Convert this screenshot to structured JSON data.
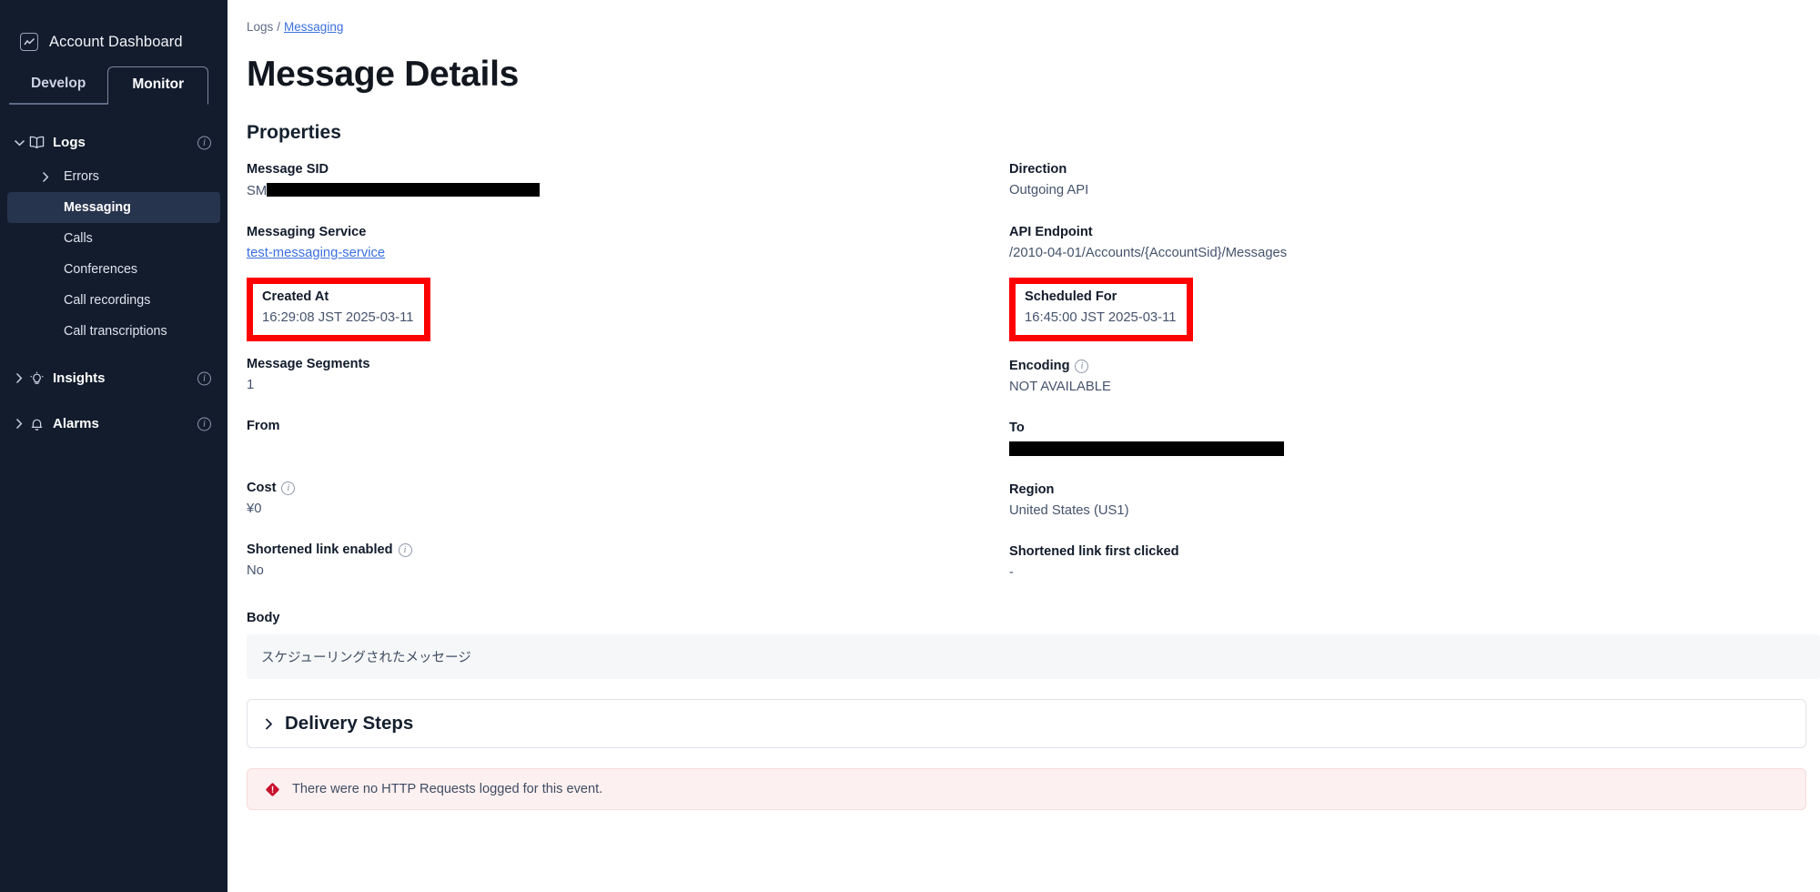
{
  "sidebar": {
    "account": {
      "label": "Account Dashboard",
      "icon": "chart-square-icon"
    },
    "tabs": [
      {
        "label": "Develop",
        "active": false
      },
      {
        "label": "Monitor",
        "active": true
      }
    ],
    "nav": [
      {
        "label": "Logs",
        "icon": "book-icon",
        "expanded": true,
        "info": true,
        "children": [
          {
            "label": "Errors",
            "caret": true,
            "active": false
          },
          {
            "label": "Messaging",
            "caret": false,
            "active": true
          },
          {
            "label": "Calls",
            "caret": false,
            "active": false
          },
          {
            "label": "Conferences",
            "caret": false,
            "active": false
          },
          {
            "label": "Call recordings",
            "caret": false,
            "active": false
          },
          {
            "label": "Call transcriptions",
            "caret": false,
            "active": false
          }
        ]
      },
      {
        "label": "Insights",
        "icon": "lightbulb-icon",
        "expanded": false,
        "info": true,
        "children": []
      },
      {
        "label": "Alarms",
        "icon": "bell-icon",
        "expanded": false,
        "info": true,
        "children": []
      }
    ]
  },
  "breadcrumb": {
    "root": "Logs",
    "separator": "/",
    "current": "Messaging"
  },
  "page": {
    "title": "Message Details",
    "section": "Properties"
  },
  "properties": {
    "left": {
      "message_sid": {
        "label": "Message SID",
        "value_prefix": "SM",
        "value_redacted": true
      },
      "messaging_service": {
        "label": "Messaging Service",
        "value": "test-messaging-service",
        "is_link": true
      },
      "created_at": {
        "label": "Created At",
        "value": "16:29:08 JST 2025-03-11",
        "highlighted": true
      },
      "message_segments": {
        "label": "Message Segments",
        "value": "1"
      },
      "from": {
        "label": "From",
        "value": ""
      },
      "cost": {
        "label": "Cost",
        "value": "¥0",
        "info": true
      },
      "shortened_link_enabled": {
        "label": "Shortened link enabled",
        "value": "No",
        "info": true
      }
    },
    "right": {
      "direction": {
        "label": "Direction",
        "value": "Outgoing API"
      },
      "api_endpoint": {
        "label": "API Endpoint",
        "value": "/2010-04-01/Accounts/{AccountSid}/Messages"
      },
      "scheduled_for": {
        "label": "Scheduled For",
        "value": "16:45:00 JST 2025-03-11",
        "highlighted": true
      },
      "encoding": {
        "label": "Encoding",
        "value": "NOT AVAILABLE",
        "info": true
      },
      "to": {
        "label": "To",
        "value": "",
        "value_redacted": true
      },
      "region": {
        "label": "Region",
        "value": "United States (US1)"
      },
      "shortened_link_first_clicked": {
        "label": "Shortened link first clicked",
        "value": "-"
      }
    }
  },
  "body": {
    "label": "Body",
    "text": "スケジューリングされたメッセージ"
  },
  "delivery_steps": {
    "title": "Delivery Steps",
    "expanded": false,
    "icon": "chevron-right-icon"
  },
  "alert": {
    "text": "There were no HTTP Requests logged for this event.",
    "icon": "error-diamond-icon"
  },
  "colors": {
    "sidebar_bg": "#121c2d",
    "sidebar_active": "#27344d",
    "link": "#3a6fe0",
    "highlight_box": "#ff0000",
    "alert_bg": "#fdf0f0",
    "alert_icon": "#c8102e",
    "body_bg": "#f6f7f8"
  }
}
